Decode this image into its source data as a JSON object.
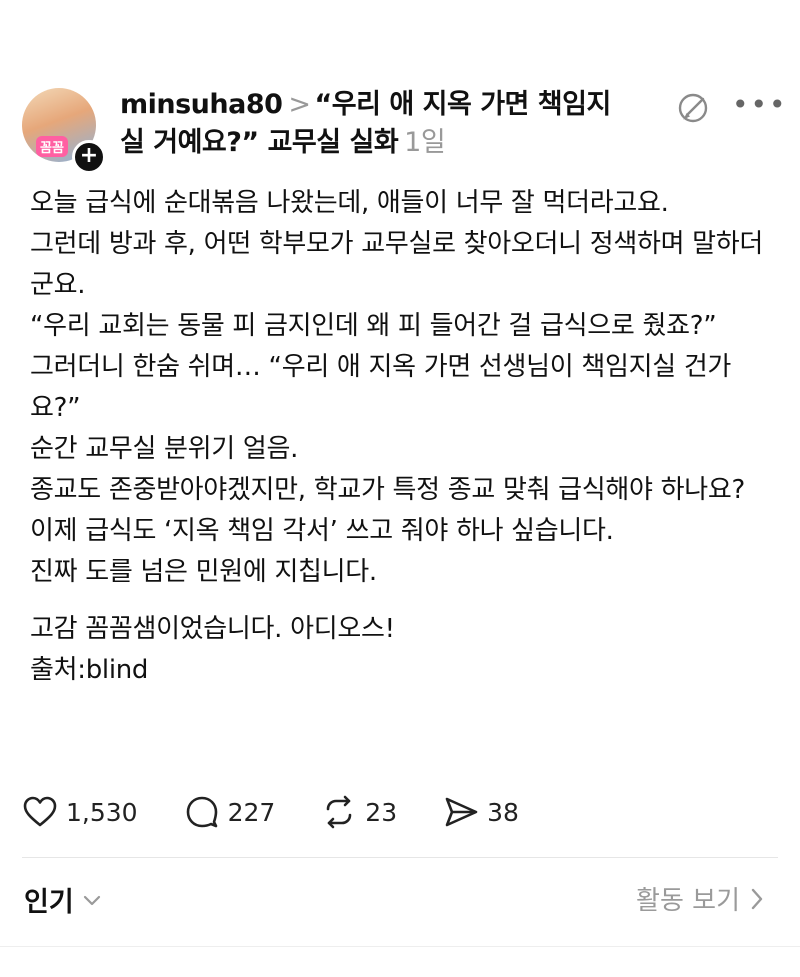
{
  "post": {
    "username": "minsuha80",
    "chevron": ">",
    "title_line1": "“우리 애 지옥 가면 책임지",
    "title_line2": "실 거예요?” 교무실 실화",
    "time": "1일",
    "avatar_badge": "꼼꼼",
    "follow_plus": "+",
    "body": [
      "오늘 급식에 순대볶음 나왔는데, 애들이 너무 잘 먹더라고요.",
      "그런데 방과 후, 어떤 학부모가 교무실로 찾아오더니 정색하며 말하더군요.",
      "“우리 교회는 동물 피 금지인데 왜 피 들어간 걸 급식으로 줬죠?”",
      "그러더니 한숨 쉬며… “우리 애 지옥 가면 선생님이 책임지실 건가요?”",
      "순간 교무실 분위기 얼음.",
      "종교도 존중받아야겠지만, 학교가 특정 종교 맞춰 급식해야 하나요?",
      "이제 급식도 ‘지옥 책임 각서’ 쓰고 줘야 하나 싶습니다.",
      "진짜 도를 넘은 민원에 지칩니다."
    ],
    "signoff": "고감 꼼꼼샘이었습니다. 아디오스!",
    "source": "출처:blind"
  },
  "actions": {
    "likes": "1,530",
    "comments": "227",
    "reposts": "23",
    "shares": "38"
  },
  "footer": {
    "sort_label": "인기",
    "activity_label": "활동 보기"
  }
}
